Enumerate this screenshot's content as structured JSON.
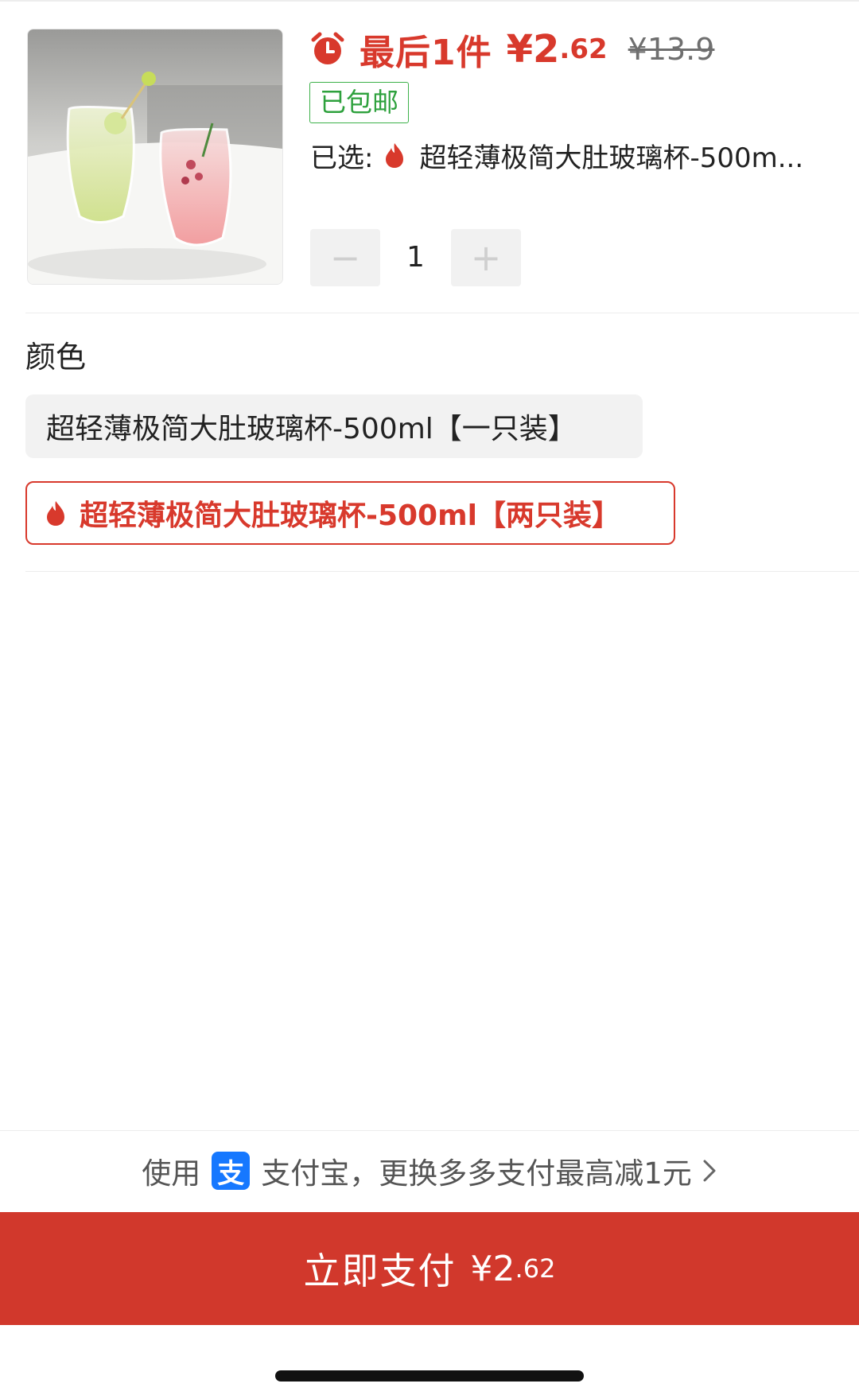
{
  "product": {
    "image_alt": "",
    "promo_label": "最后1件",
    "price_int": "¥2",
    "price_dec": ".62",
    "original_price": "¥13.9",
    "shipping_badge": "已包邮",
    "selected_prefix": "已选: ",
    "selected_value": "超轻薄极简大肚玻璃杯-500m..."
  },
  "quantity": {
    "minus_label": "−",
    "value": "1",
    "plus_label": "+"
  },
  "options": {
    "title": "颜色",
    "items": [
      {
        "label": "超轻薄极简大肚玻璃杯-500ml【一只装】",
        "selected": false
      },
      {
        "label": "超轻薄极简大肚玻璃杯-500ml【两只装】",
        "selected": true
      }
    ]
  },
  "payment_hint": {
    "prefix": "使用",
    "icon_glyph": "支",
    "text": "支付宝，更换多多支付最高减1元"
  },
  "pay_button": {
    "label": "立即支付",
    "amount_int": "¥2",
    "amount_dec": ".62"
  },
  "colors": {
    "accent": "#d8392c",
    "pay_button": "#d1382c",
    "shipping_green": "#2ea13d",
    "alipay_blue": "#1678ff"
  },
  "icons": [
    "alarm-clock-icon",
    "flame-icon",
    "alipay-icon",
    "chevron-right-icon"
  ]
}
